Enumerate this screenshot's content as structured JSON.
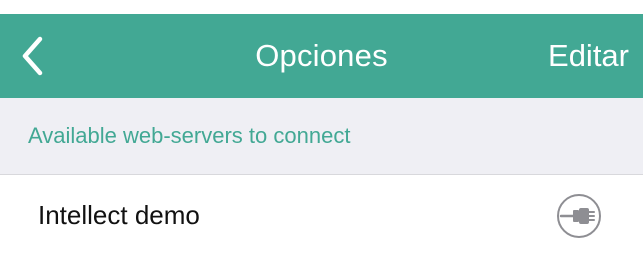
{
  "nav": {
    "back_icon": "chevron-left-icon",
    "title": "Opciones",
    "edit_label": "Editar"
  },
  "section": {
    "header": "Available web-servers to connect"
  },
  "servers": [
    {
      "name": "Intellect demo",
      "action_icon": "plug-icon"
    }
  ],
  "colors": {
    "accent": "#42a894",
    "section_bg": "#efeff4",
    "icon_gray": "#8e8e93"
  }
}
